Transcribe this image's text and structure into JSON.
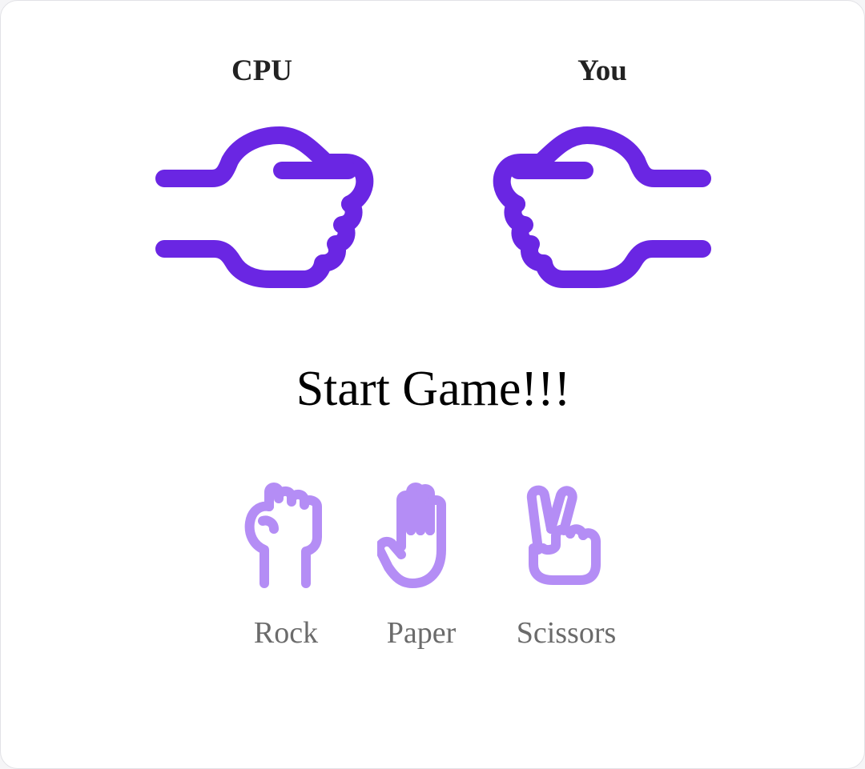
{
  "players": {
    "cpu_label": "CPU",
    "you_label": "You"
  },
  "status_text": "Start Game!!!",
  "choices": [
    {
      "label": "Rock",
      "icon": "rock-hand-icon"
    },
    {
      "label": "Paper",
      "icon": "paper-hand-icon"
    },
    {
      "label": "Scissors",
      "icon": "scissors-hand-icon"
    }
  ],
  "colors": {
    "big_hand": "#6a26e3",
    "choice_icon": "#b48df5",
    "choice_label": "#6b6b6b"
  }
}
